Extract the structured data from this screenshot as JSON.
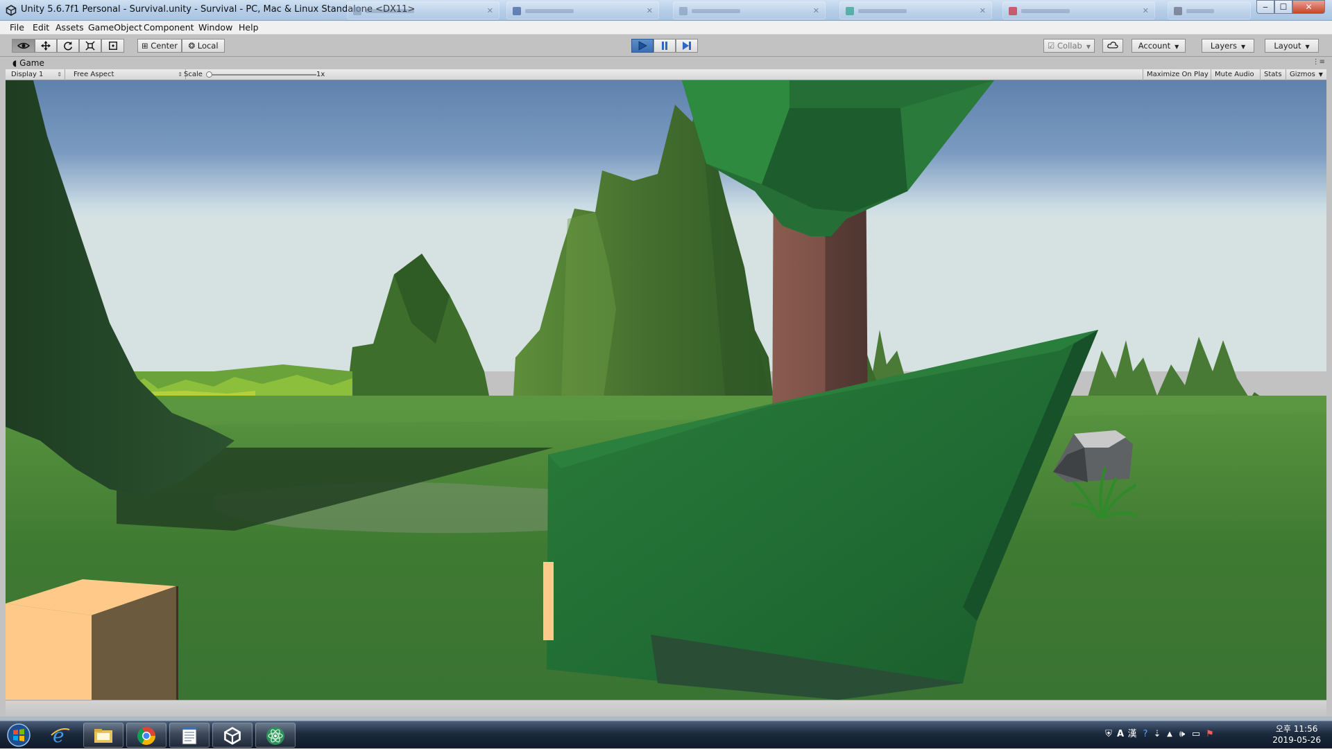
{
  "window": {
    "title": "Unity 5.6.7f1 Personal - Survival.unity - Survival - PC, Mac & Linux Standalone <DX11>",
    "minimize_glyph": "‒",
    "maximize_glyph": "☐",
    "close_glyph": "✕"
  },
  "menu": {
    "items": [
      "File",
      "Edit",
      "Assets",
      "GameObject",
      "Component",
      "Window",
      "Help"
    ]
  },
  "toolbar": {
    "tools": [
      "view-tool",
      "move-tool",
      "rotate-tool",
      "scale-tool",
      "rect-tool"
    ],
    "active_tool": "view-tool",
    "pivot_label": "Center",
    "space_label": "Local",
    "play_state": "playing",
    "collab_label": "Collab",
    "account_label": "Account",
    "layers_label": "Layers",
    "layout_label": "Layout"
  },
  "game_tab": {
    "label": "Game"
  },
  "game_controls": {
    "display": "Display 1",
    "aspect": "Free Aspect",
    "scale_label": "Scale",
    "scale_value": "1x",
    "scale_level": 0,
    "toggles": [
      "Maximize On Play",
      "Mute Audio",
      "Stats",
      "Gizmos"
    ]
  },
  "taskbar": {
    "apps": [
      "internet-explorer",
      "file-explorer",
      "chrome",
      "notepad",
      "unity",
      "atom"
    ],
    "tray_text": [
      "A",
      "漢"
    ],
    "clock_time": "오후 11:56",
    "clock_date": "2019-05-26"
  },
  "colors": {
    "sky_top": "#5f82ad",
    "sky_horizon": "#c9dbe3",
    "ground": "#3f7a32",
    "foliage": "#236b34",
    "trunk": "#7d5148",
    "block": "#ffc98a",
    "play_blue": "#3b6fb0"
  }
}
